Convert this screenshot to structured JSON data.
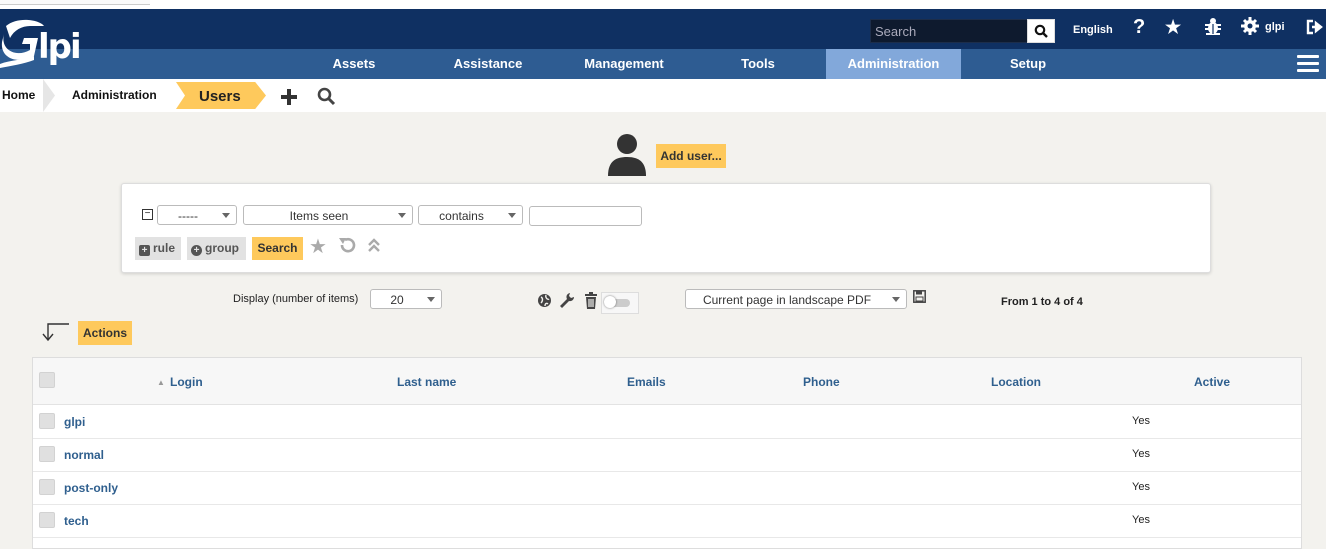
{
  "app": {
    "logo_text": "Glpi"
  },
  "header": {
    "search_placeholder": "Search",
    "language": "English",
    "user": "glpi",
    "icons": [
      "search-icon",
      "help-icon",
      "star-icon",
      "bug-icon",
      "gear-icon",
      "logout-icon"
    ]
  },
  "menu": {
    "items": [
      {
        "label": "Assets",
        "active": false
      },
      {
        "label": "Assistance",
        "active": false
      },
      {
        "label": "Management",
        "active": false
      },
      {
        "label": "Tools",
        "active": false
      },
      {
        "label": "Administration",
        "active": true
      },
      {
        "label": "Setup",
        "active": false
      }
    ]
  },
  "breadcrumb": {
    "items": [
      "Home",
      "Administration",
      "Users"
    ]
  },
  "add_user_label": "Add user...",
  "search_panel": {
    "field_select": "-----",
    "item_select": "Items seen",
    "operator_select": "contains",
    "value": "",
    "rule_label": "rule",
    "group_label": "group",
    "search_label": "Search"
  },
  "list_controls": {
    "display_label": "Display (number of items)",
    "display_value": "20",
    "export_option": "Current page in landscape PDF",
    "pagination": "From 1 to 4 of 4"
  },
  "actions_label": "Actions",
  "table": {
    "columns": [
      "Login",
      "Last name",
      "Emails",
      "Phone",
      "Location",
      "Active"
    ],
    "sort_indicator": "▲",
    "rows": [
      {
        "login": "glpi",
        "active": "Yes"
      },
      {
        "login": "normal",
        "active": "Yes"
      },
      {
        "login": "post-only",
        "active": "Yes"
      },
      {
        "login": "tech",
        "active": "Yes"
      }
    ]
  },
  "colors": {
    "header": "#0f3062",
    "menubar": "#2e5c92",
    "active_menu": "#82a8da",
    "accent": "#fec95c",
    "link": "#2f5f8e"
  }
}
